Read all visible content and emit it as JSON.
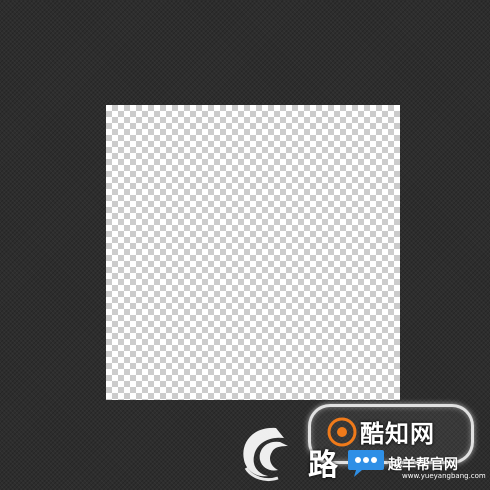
{
  "workspace": {
    "background_color": "#2d2d2d"
  },
  "canvas": {
    "transparent": true,
    "checker_light": "#ffffff",
    "checker_dark": "#cccccc"
  },
  "watermarks": {
    "badge_text": "酷知网",
    "site_name": "越羊帮官网",
    "site_url": "www.yueyangbang.com",
    "left_glyph": "路",
    "accent_color": "#2e8fe6",
    "badge_mark_color": "#f07a1a"
  }
}
